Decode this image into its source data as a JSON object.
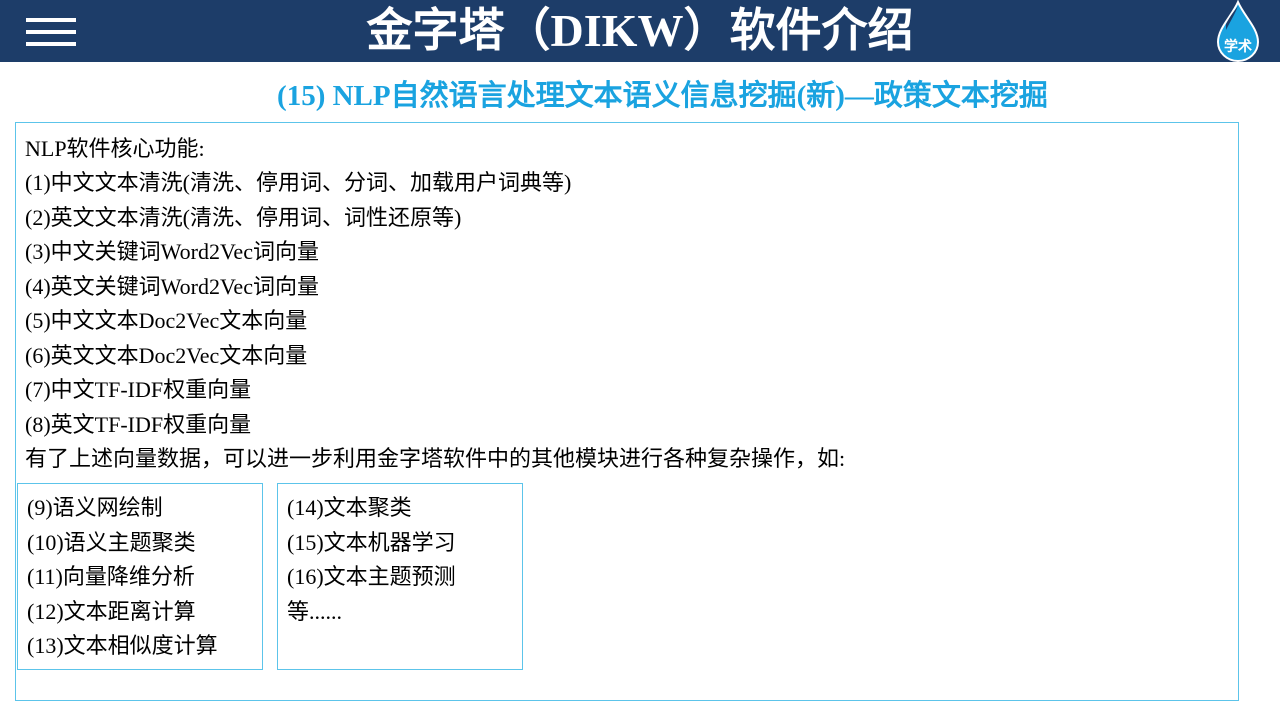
{
  "header": {
    "title": "金字塔（DIKW）软件介绍",
    "logo_text": "学术",
    "menu_icon": "hamburger-icon",
    "bg_color": "#1d3d69"
  },
  "subtitle": "(15) NLP自然语言处理文本语义信息挖掘(新)—政策文本挖掘",
  "accent_color": "#1aa3e0",
  "main": {
    "lines": [
      "NLP软件核心功能:",
      "(1)中文文本清洗(清洗、停用词、分词、加载用户词典等)",
      "(2)英文文本清洗(清洗、停用词、词性还原等)",
      "(3)中文关键词Word2Vec词向量",
      "(4)英文关键词Word2Vec词向量",
      "(5)中文文本Doc2Vec文本向量",
      "(6)英文文本Doc2Vec文本向量",
      "(7)中文TF-IDF权重向量",
      "(8)英文TF-IDF权重向量",
      "有了上述向量数据，可以进一步利用金字塔软件中的其他模块进行各种复杂操作，如:"
    ],
    "box1": [
      "(9)语义网绘制",
      "(10)语义主题聚类",
      "(11)向量降维分析",
      "(12)文本距离计算",
      "(13)文本相似度计算"
    ],
    "box2": [
      "(14)文本聚类",
      "(15)文本机器学习",
      "(16)文本主题预测",
      "等......"
    ]
  }
}
